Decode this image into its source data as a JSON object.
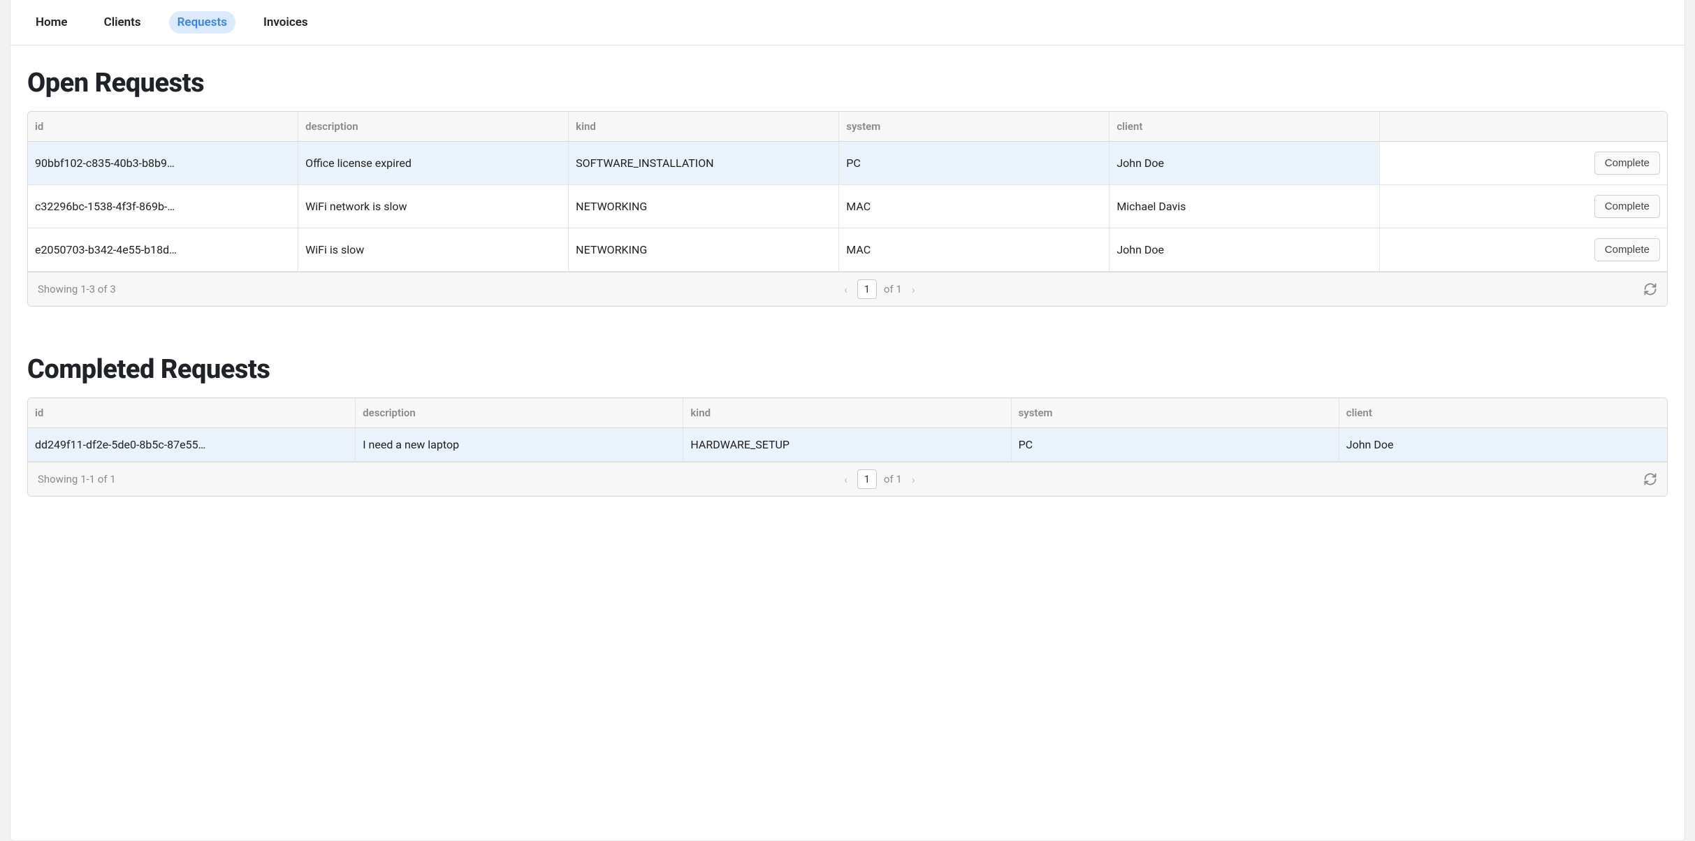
{
  "nav": {
    "items": [
      {
        "label": "Home",
        "name": "nav-home",
        "active": false
      },
      {
        "label": "Clients",
        "name": "nav-clients",
        "active": false
      },
      {
        "label": "Requests",
        "name": "nav-requests",
        "active": true
      },
      {
        "label": "Invoices",
        "name": "nav-invoices",
        "active": false
      }
    ]
  },
  "open": {
    "title": "Open Requests",
    "columns": [
      "id",
      "description",
      "kind",
      "system",
      "client"
    ],
    "action_label": "Complete",
    "rows": [
      {
        "id": "90bbf102-c835-40b3-b8b9…",
        "description": "Office license expired",
        "kind": "SOFTWARE_INSTALLATION",
        "system": "PC",
        "client": "John Doe",
        "highlight": true
      },
      {
        "id": "c32296bc-1538-4f3f-869b-…",
        "description": "WiFi network is slow",
        "kind": "NETWORKING",
        "system": "MAC",
        "client": "Michael Davis",
        "highlight": false
      },
      {
        "id": "e2050703-b342-4e55-b18d…",
        "description": "WiFi is slow",
        "kind": "NETWORKING",
        "system": "MAC",
        "client": "John Doe",
        "highlight": false
      }
    ],
    "footer": {
      "showing": "Showing 1-3 of 3",
      "page": "1",
      "of_text": "of 1"
    }
  },
  "completed": {
    "title": "Completed Requests",
    "columns": [
      "id",
      "description",
      "kind",
      "system",
      "client"
    ],
    "rows": [
      {
        "id": "dd249f11-df2e-5de0-8b5c-87e55…",
        "description": "I need a new laptop",
        "kind": "HARDWARE_SETUP",
        "system": "PC",
        "client": "John Doe",
        "highlight": true
      }
    ],
    "footer": {
      "showing": "Showing 1-1 of 1",
      "page": "1",
      "of_text": "of 1"
    }
  }
}
